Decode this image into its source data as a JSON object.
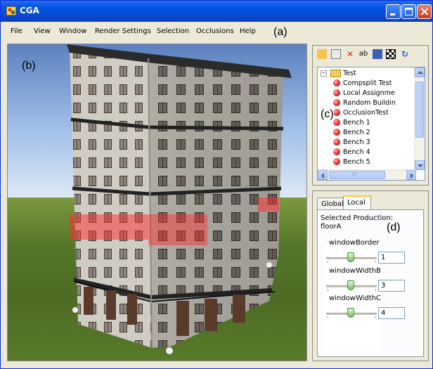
{
  "window": {
    "title": "CGA"
  },
  "menu": [
    "File",
    "View",
    "Window",
    "Render Settings",
    "Selection",
    "Occlusions",
    "Help"
  ],
  "callouts": {
    "a": "(a)",
    "b": "(b)",
    "c": "(c)",
    "d": "(d)"
  },
  "toolbar": [
    "open-folder-icon",
    "edit-icon",
    "delete-icon",
    "spellcheck-icon",
    "save-icon",
    "grid-icon",
    "refresh-icon"
  ],
  "tree": {
    "root": "Test",
    "items": [
      "Compsplit Test",
      "Local Assignme",
      "Random Buildin",
      "OcclusionTest",
      "Bench 1",
      "Bench 2",
      "Bench 3",
      "Bench 4",
      "Bench 5"
    ]
  },
  "scroll_grip": "III",
  "tabs": {
    "global": "Global",
    "local": "Local"
  },
  "selected_production": {
    "label": "Selected Production:",
    "value": "floorA"
  },
  "params": [
    {
      "name": "windowBorder",
      "value": "1"
    },
    {
      "name": "windowWidthB",
      "value": "3"
    },
    {
      "name": "windowWidthC",
      "value": "4"
    }
  ],
  "colors": {
    "titlebar": "#0a49d0",
    "chrome": "#ece9d8",
    "highlight": "#ff3030"
  }
}
